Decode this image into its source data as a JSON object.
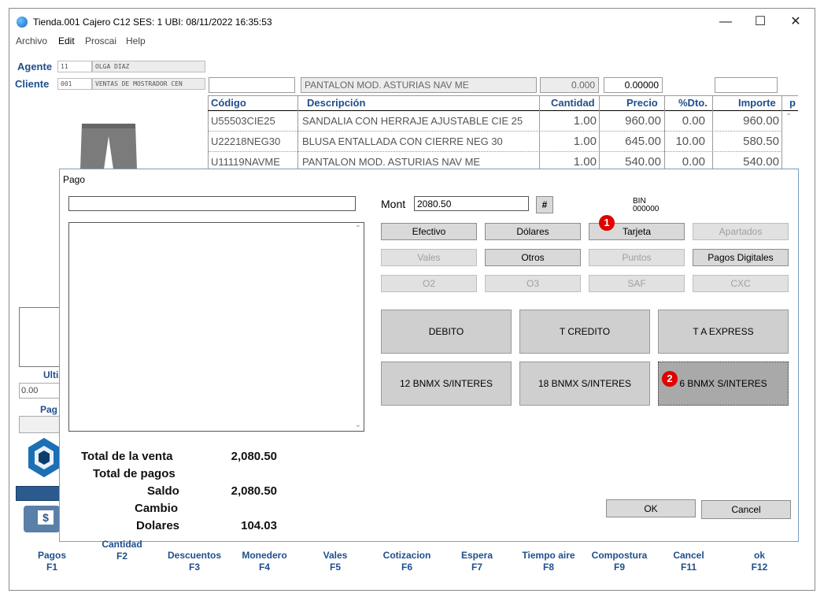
{
  "window": {
    "title": "Tienda.001  Cajero C12    SES: 1  UBI:   08/11/2022 16:35:53",
    "menu": [
      "Archivo",
      "Edit",
      "Proscai",
      "Help"
    ]
  },
  "header": {
    "agente_label": "Agente",
    "agente_code": "11",
    "agente_name": "OLGA DIAZ",
    "cliente_label": "Cliente",
    "cliente_code": "001",
    "cliente_name": "VENTAS DE MOSTRADOR CEN",
    "item_code": "",
    "item_desc": "PANTALON MOD. ASTURIAS NAV ME",
    "item_qty": "0.000",
    "item_price": "0.00000",
    "item_extra": ""
  },
  "grid": {
    "headers": [
      "Código",
      "Descripción",
      "Cantidad",
      "Precio",
      "%Dto.",
      "Importe",
      "p"
    ],
    "rows": [
      {
        "codigo": "U55503CIE25",
        "descripcion": "SANDALIA CON HERRAJE AJUSTABLE CIE 25",
        "cantidad": "1.00",
        "precio": "960.00",
        "dto": "0.00",
        "importe": "960.00"
      },
      {
        "codigo": "U22218NEG30",
        "descripcion": "BLUSA ENTALLADA CON CIERRE NEG 30",
        "cantidad": "1.00",
        "precio": "645.00",
        "dto": "10.00",
        "importe": "580.50"
      },
      {
        "codigo": "U11119NAVME",
        "descripcion": "PANTALON MOD. ASTURIAS NAV ME",
        "cantidad": "1.00",
        "precio": "540.00",
        "dto": "0.00",
        "importe": "540.00"
      }
    ]
  },
  "left_panel": {
    "ulti_label": "Ulti",
    "ulti_value": "0.00",
    "pag_label": "Pag",
    "cash_icon_text": "$"
  },
  "dialog": {
    "title": "Pago",
    "mont_label": "Mont",
    "mont_value": "2080.50",
    "hash_button": "#",
    "bin_label": "BIN",
    "bin_value": "000000",
    "methods": [
      {
        "label": "Efectivo",
        "enabled": true
      },
      {
        "label": "Dólares",
        "enabled": true
      },
      {
        "label": "Tarjeta",
        "enabled": true
      },
      {
        "label": "Apartados",
        "enabled": false
      },
      {
        "label": "Vales",
        "enabled": false
      },
      {
        "label": "Otros",
        "enabled": true
      },
      {
        "label": "Puntos",
        "enabled": false
      },
      {
        "label": "Pagos Digitales",
        "enabled": true
      },
      {
        "label": "O2",
        "enabled": false
      },
      {
        "label": "O3",
        "enabled": false
      },
      {
        "label": "SAF",
        "enabled": false
      },
      {
        "label": "CXC",
        "enabled": false
      }
    ],
    "card_types": [
      "DEBITO",
      "T CREDITO",
      "T A EXPRESS",
      "12 BNMX S/INTERES",
      "18 BNMX S/INTERES",
      "6 BNMX S/INTERES"
    ],
    "badges": [
      "1",
      "2"
    ],
    "totals": {
      "venta_label": "Total de la venta",
      "venta_value": "2,080.50",
      "pagos_label": "Total de pagos",
      "pagos_value": "",
      "saldo_label": "Saldo",
      "saldo_value": "2,080.50",
      "cambio_label": "Cambio",
      "cambio_value": "",
      "dolares_label": "Dolares",
      "dolares_value": "104.03"
    },
    "ok_label": "OK",
    "cancel_label": "Cancel"
  },
  "fkeys": [
    {
      "label": "Pagos",
      "key": "F1"
    },
    {
      "label": "Cantidad",
      "key": "F2"
    },
    {
      "label": "Descuentos",
      "key": "F3"
    },
    {
      "label": "Monedero",
      "key": "F4"
    },
    {
      "label": "Vales",
      "key": "F5"
    },
    {
      "label": "Cotizacion",
      "key": "F6"
    },
    {
      "label": "Espera",
      "key": "F7"
    },
    {
      "label": "Tiempo aire",
      "key": "F8"
    },
    {
      "label": "Compostura",
      "key": "F9"
    },
    {
      "label": "Cancel",
      "key": "F11"
    },
    {
      "label": "ok",
      "key": "F12"
    }
  ],
  "colors": {
    "accent_blue": "#1f4e8c",
    "badge_red": "#e00000",
    "selected_button": "#a9a9a9"
  }
}
